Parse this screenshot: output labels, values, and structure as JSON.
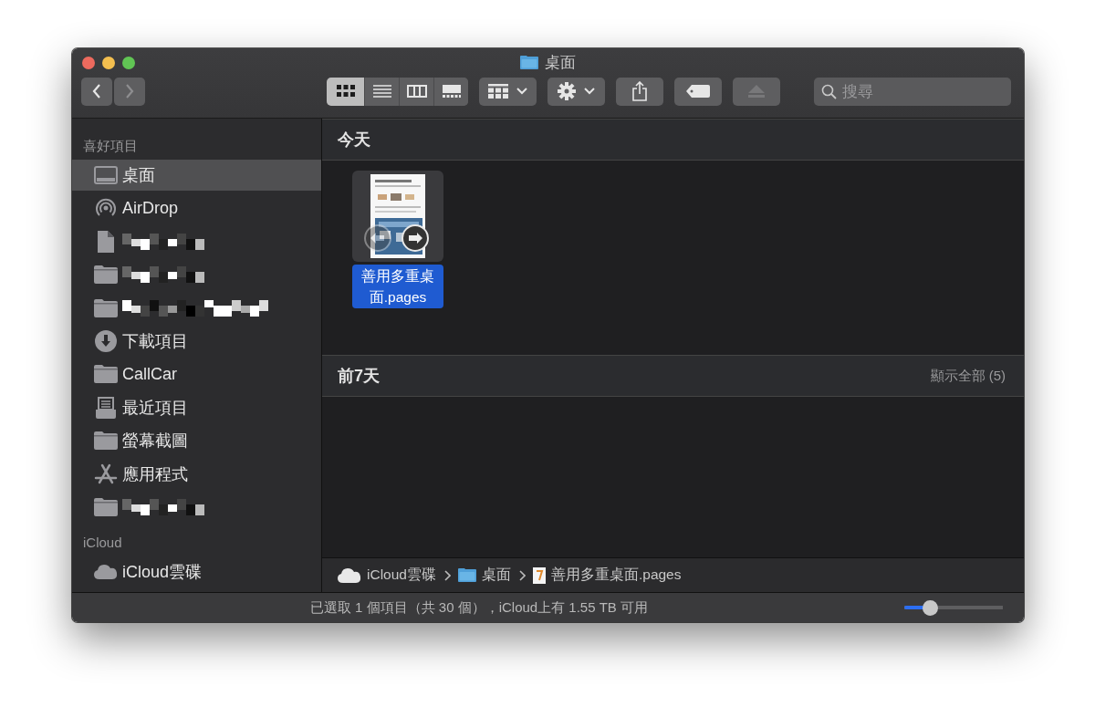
{
  "window": {
    "title": "桌面"
  },
  "navigation": [
    {
      "kind": "back",
      "disabled": false
    },
    {
      "kind": "forward",
      "disabled": true
    }
  ],
  "toolbar": {
    "views": [
      {
        "kind": "icons",
        "selected": true
      },
      {
        "kind": "list",
        "selected": false
      },
      {
        "kind": "columns",
        "selected": false
      },
      {
        "kind": "gallery",
        "selected": false
      }
    ],
    "buttons": [
      {
        "kind": "group",
        "disabled": false
      },
      {
        "kind": "action",
        "disabled": false
      },
      {
        "kind": "share",
        "disabled": false
      },
      {
        "kind": "tag",
        "disabled": false
      },
      {
        "kind": "eject",
        "disabled": true
      }
    ],
    "search": {
      "placeholder": "搜尋"
    }
  },
  "sidebar": {
    "sections": [
      {
        "title": "喜好項目",
        "items": [
          {
            "kind": "desktop",
            "label": "桌面",
            "selected": true
          },
          {
            "kind": "airdrop",
            "label": "AirDrop",
            "selected": false
          },
          {
            "kind": "redacted-file",
            "selected": false
          },
          {
            "kind": "redacted-folder",
            "selected": false
          },
          {
            "kind": "redacted-folder",
            "selected": false
          },
          {
            "kind": "download",
            "label": "下載項目",
            "selected": false
          },
          {
            "kind": "folder",
            "label": "CallCar",
            "selected": false
          },
          {
            "kind": "recent",
            "label": "最近項目",
            "selected": false
          },
          {
            "kind": "folder",
            "label": "螢幕截圖",
            "selected": false
          },
          {
            "kind": "apps",
            "label": "應用程式",
            "selected": false
          },
          {
            "kind": "redacted-folder",
            "selected": false
          }
        ]
      },
      {
        "title": "iCloud",
        "items": [
          {
            "kind": "cloud",
            "label": "iCloud雲碟",
            "selected": false
          }
        ]
      }
    ]
  },
  "content": {
    "sections": [
      {
        "title": "今天",
        "files": [
          {
            "name": "善用多重桌面.pages",
            "selected": true
          }
        ]
      },
      {
        "title": "前7天",
        "action": "顯示全部 (5)"
      }
    ]
  },
  "path_bar": [
    {
      "kind": "cloud",
      "label": "iCloud雲碟"
    },
    {
      "kind": "folder",
      "label": "桌面"
    },
    {
      "kind": "pages",
      "label": "善用多重桌面.pages"
    }
  ],
  "status_bar": {
    "text": "已選取 1 個項目（共 30 個），iCloud上有 1.55 TB 可用",
    "zoom": {
      "level": 0.26
    }
  }
}
